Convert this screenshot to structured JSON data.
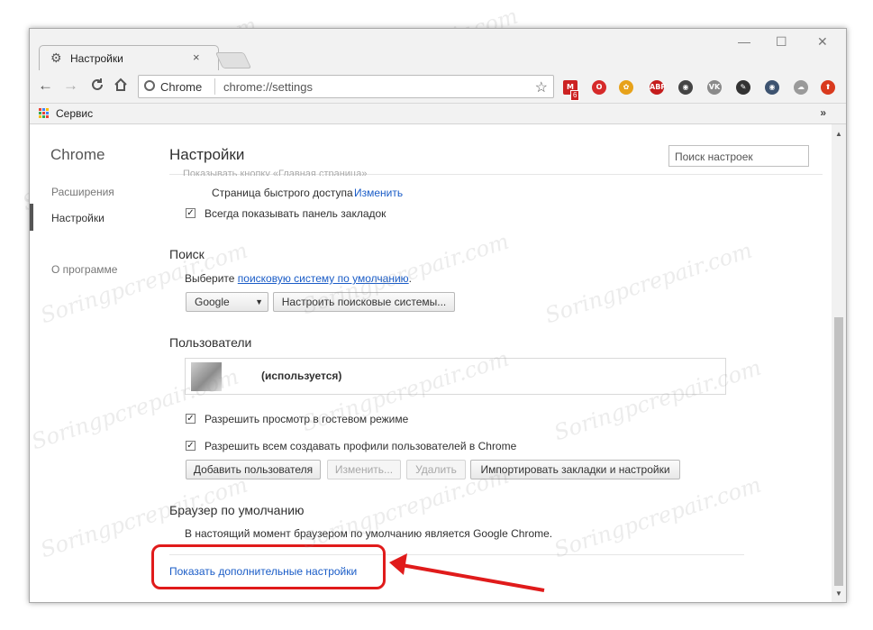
{
  "window": {
    "tab_title": "Настройки",
    "tab_close": "×",
    "controls": {
      "minimize": "—",
      "maximize": "☐",
      "close": "✕"
    }
  },
  "toolbar": {
    "back": "←",
    "forward": "→",
    "reload": "C",
    "home": "⌂",
    "site_label": "Chrome",
    "url": "chrome://settings",
    "bookmark_star": "☆",
    "extensions": [
      {
        "name": "gmail-extension-icon",
        "text": "M",
        "color": "#cc2222"
      },
      {
        "name": "opera-extension-icon",
        "text": "O",
        "color": "#d62a2a"
      },
      {
        "name": "paw-extension-icon",
        "text": "✿",
        "color": "#e7a21a"
      },
      {
        "name": "adblock-extension-icon",
        "text": "ABP",
        "color": "#c51d1d"
      },
      {
        "name": "film-extension-icon",
        "text": "◉",
        "color": "#444444"
      },
      {
        "name": "vk-extension-icon",
        "text": "VK",
        "color": "#8a8a8a"
      },
      {
        "name": "compass-extension-icon",
        "text": "✎",
        "color": "#333333"
      },
      {
        "name": "eye-extension-icon",
        "text": "◉",
        "color": "#3d5370"
      },
      {
        "name": "cloud-extension-icon",
        "text": "☁",
        "color": "#9a9a9a"
      },
      {
        "name": "upload-extension-icon",
        "text": "⬆",
        "color": "#d93a1e"
      }
    ],
    "gmail_badge": "6"
  },
  "bookmarks_bar": {
    "apps_label": "Сервис",
    "overflow": "»"
  },
  "sidebar": {
    "brand": "Chrome",
    "items": [
      {
        "label": "Расширения"
      },
      {
        "label": "Настройки"
      },
      {
        "label": "О программе"
      }
    ]
  },
  "header": {
    "title": "Настройки",
    "search_placeholder": "Поиск настроек"
  },
  "appearance": {
    "home_button_label": "Показывать кнопку «Главная страница»",
    "quick_access": "Страница быстрого доступа",
    "change_link": "Изменить",
    "show_bookmarks_bar": "Всегда показывать панель закладок"
  },
  "search_section": {
    "title": "Поиск",
    "intro_prefix": "Выберите",
    "intro_link": "поисковую систему по умолчанию",
    "intro_suffix": ".",
    "engine_value": "Google",
    "manage_button": "Настроить поисковые системы..."
  },
  "users_section": {
    "title": "Пользователи",
    "current_user_label": "(используется)",
    "guest_mode": "Разрешить просмотр в гостевом режиме",
    "allow_profiles": "Разрешить всем создавать профили пользователей в Chrome",
    "add_user": "Добавить пользователя",
    "edit": "Изменить...",
    "remove": "Удалить",
    "import": "Импортировать закладки и настройки"
  },
  "default_browser": {
    "title": "Браузер по умолчанию",
    "status": "В настоящий момент браузером по умолчанию является Google Chrome."
  },
  "advanced_link": "Показать дополнительные настройки",
  "watermark": "Soringpcrepair.com",
  "colors": {
    "link": "#1a5cc7",
    "highlight": "#e01b1b"
  }
}
